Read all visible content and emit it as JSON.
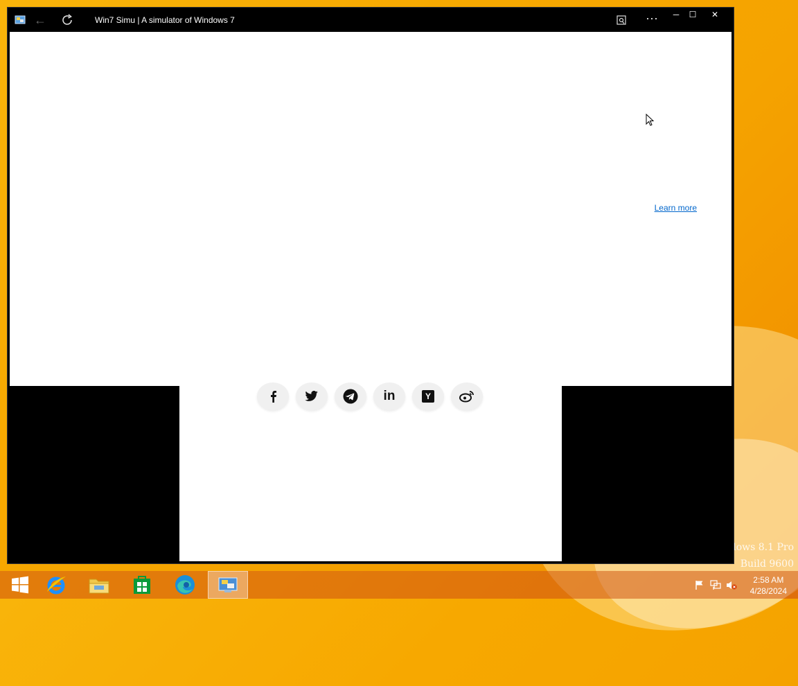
{
  "window": {
    "title": "Win7 Simu | A simulator of Windows 7",
    "controls": {
      "minimize": "─",
      "maximize": "☐",
      "close": "✕"
    }
  },
  "content": {
    "learn_more": "Learn more"
  },
  "social_buttons": [
    {
      "name": "facebook",
      "glyph": "f"
    },
    {
      "name": "twitter",
      "glyph": "🐦"
    },
    {
      "name": "telegram",
      "glyph": "➤"
    },
    {
      "name": "linkedin",
      "glyph": "in"
    },
    {
      "name": "hackernews",
      "glyph": "Y"
    },
    {
      "name": "weibo",
      "glyph": "微"
    }
  ],
  "desktop": {
    "watermark_line1": "dows 8.1 Pro",
    "watermark_line2": "Build 9600"
  },
  "taskbar": {
    "time": "2:58 AM",
    "date": "4/28/2024"
  }
}
